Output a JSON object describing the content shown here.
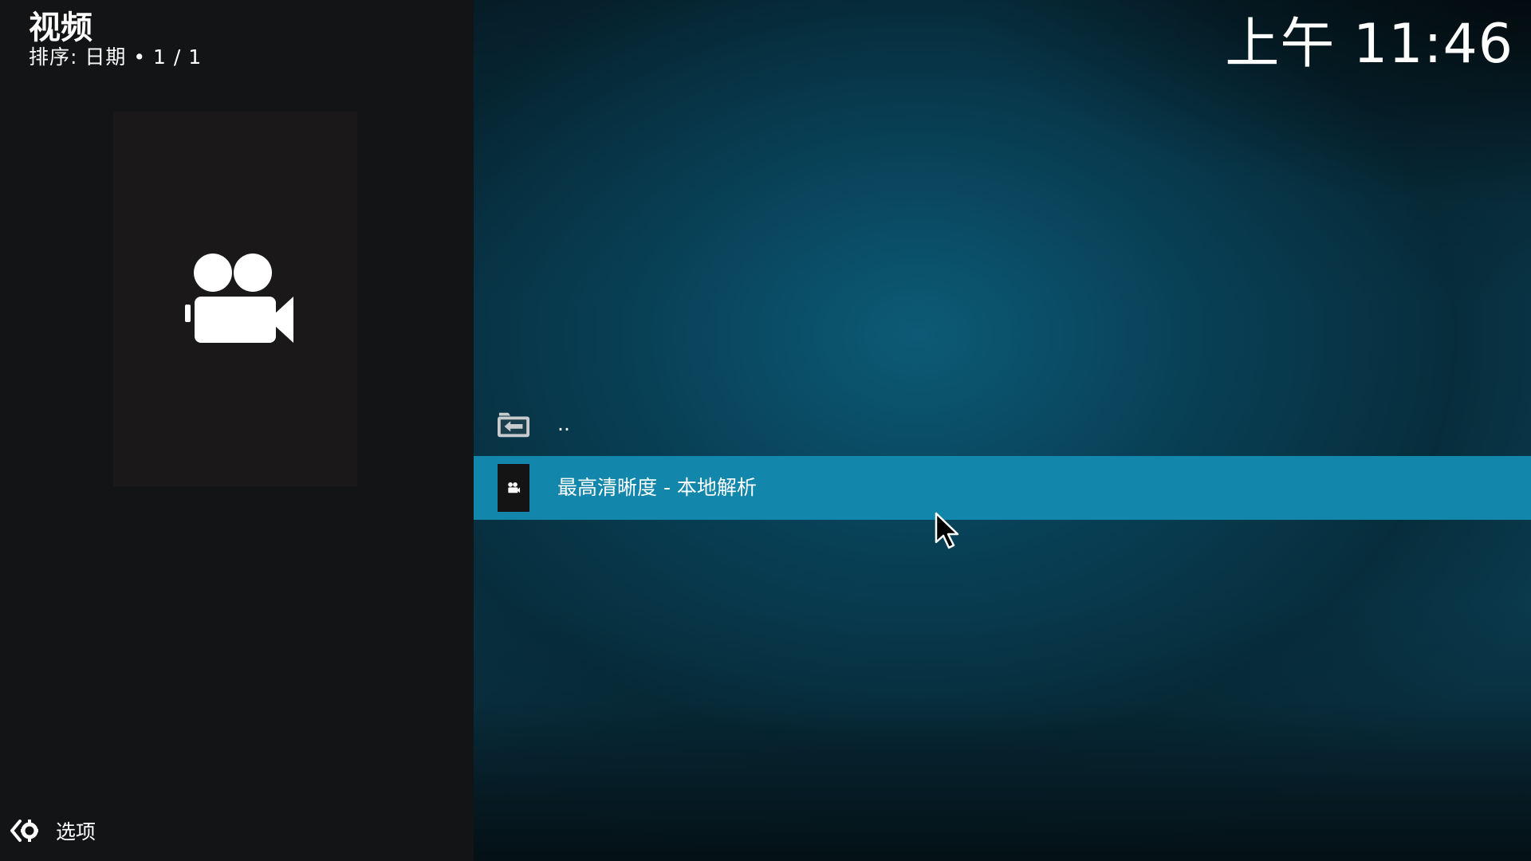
{
  "header": {
    "title": "视频",
    "subtitle": "排序: 日期  •  1 / 1"
  },
  "clock": "上午 11:46",
  "list": {
    "items": [
      {
        "label": "..",
        "icon": "folder-back-icon",
        "selected": false
      },
      {
        "label": "最高清晰度 - 本地解析",
        "icon": "video-camera-icon",
        "selected": true
      }
    ]
  },
  "footer": {
    "options_label": "选项",
    "options_icon": "options-gear-icon"
  },
  "thumbnail": {
    "icon": "video-camera-icon"
  },
  "colors": {
    "accent": "#1287ab",
    "left_panel": "#121416",
    "background": "#0a3b4e"
  }
}
